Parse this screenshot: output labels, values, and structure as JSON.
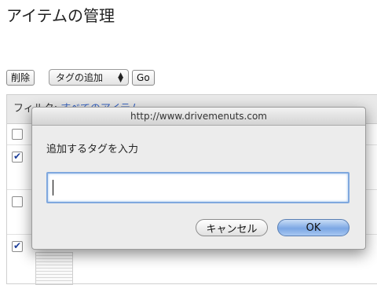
{
  "page": {
    "title": "アイテムの管理"
  },
  "toolbar": {
    "delete_label": "削除",
    "tag_select_value": "タグの追加",
    "go_label": "Go"
  },
  "table": {
    "filter_label": "フィルタ:",
    "filter_value": "すべてのアイテム",
    "rows": [
      {
        "checked": false,
        "mark": ""
      },
      {
        "checked": true,
        "mark": "✔"
      },
      {
        "checked": false,
        "mark": ""
      },
      {
        "checked": true,
        "mark": "✔"
      }
    ]
  },
  "dialog": {
    "title": "http://www.drivemenuts.com",
    "prompt": "追加するタグを入力",
    "input_value": "",
    "cancel_label": "キャンセル",
    "ok_label": "OK"
  },
  "colors": {
    "ok_button": "#7ba7e4",
    "filter_link": "#3a66c4"
  }
}
